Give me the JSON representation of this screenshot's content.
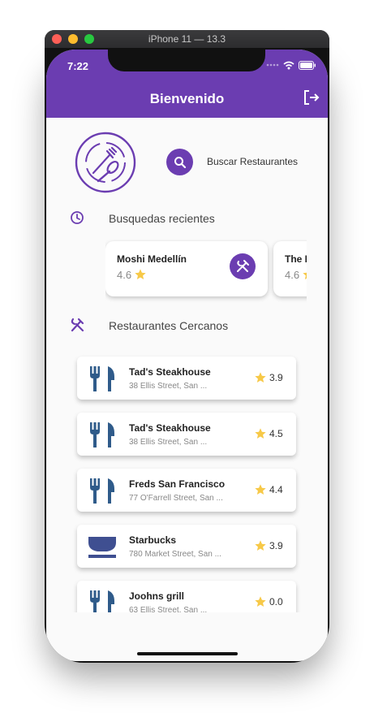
{
  "simulator": {
    "title": "iPhone 11 — 13.3"
  },
  "status_bar": {
    "time": "7:22"
  },
  "appbar": {
    "title": "Bienvenido",
    "logout_icon": "logout-icon"
  },
  "search": {
    "label": "Buscar Restaurantes",
    "icon": "search-icon"
  },
  "recent": {
    "title": "Busquedas recientes",
    "icon": "clock-icon",
    "items": [
      {
        "name": "Moshi Medellín",
        "rating": "4.6"
      },
      {
        "name": "The I",
        "rating": "4.6"
      }
    ]
  },
  "nearby": {
    "title": "Restaurantes Cercanos",
    "icon": "utensils-icon",
    "items": [
      {
        "name": "Tad's Steakhouse",
        "address": "38 Ellis Street, San ...",
        "rating": "3.9",
        "icon": "fork-knife-icon"
      },
      {
        "name": "Tad's Steakhouse",
        "address": "38 Ellis Street, San ...",
        "rating": "4.5",
        "icon": "fork-knife-icon"
      },
      {
        "name": "Freds San Francisco",
        "address": "77 O'Farrell Street, San ...",
        "rating": "4.4",
        "icon": "fork-knife-icon"
      },
      {
        "name": "Starbucks",
        "address": "780 Market Street, San ...",
        "rating": "3.9",
        "icon": "coffee-bowl-icon"
      },
      {
        "name": "Joohns grill",
        "address": "63 Ellis Street, San ...",
        "rating": "0.0",
        "icon": "fork-knife-icon"
      }
    ]
  },
  "colors": {
    "primary": "#6b3db1",
    "star": "#f7c948",
    "utensil_blue": "#2f5b8a",
    "starbucks_blue": "#3f4f91"
  }
}
